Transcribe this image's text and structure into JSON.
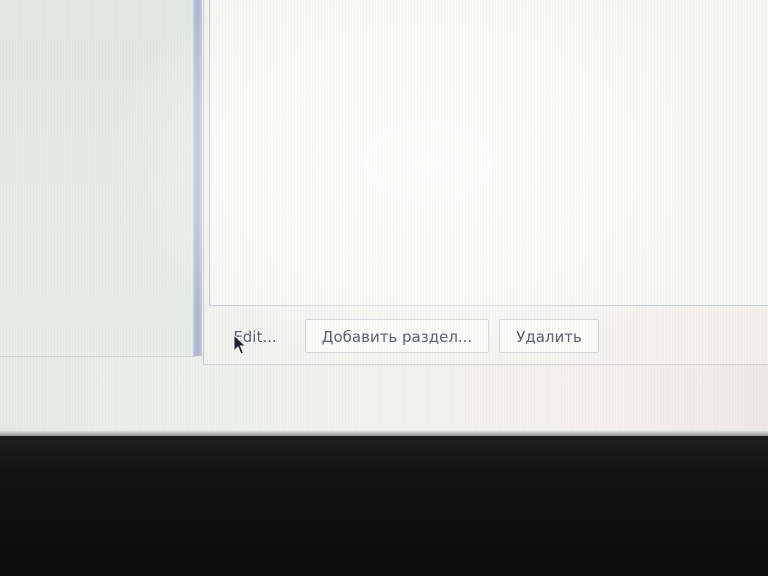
{
  "buttons": {
    "edit_label": "Edit...",
    "add_section_label": "Добавить раздел...",
    "delete_label": "Удалить"
  },
  "icons": {
    "pointer": "mouse-cursor-icon"
  },
  "colors": {
    "button_text": "#5a6170",
    "split_bar": "#a9b5cf",
    "bezel": "#121213"
  }
}
